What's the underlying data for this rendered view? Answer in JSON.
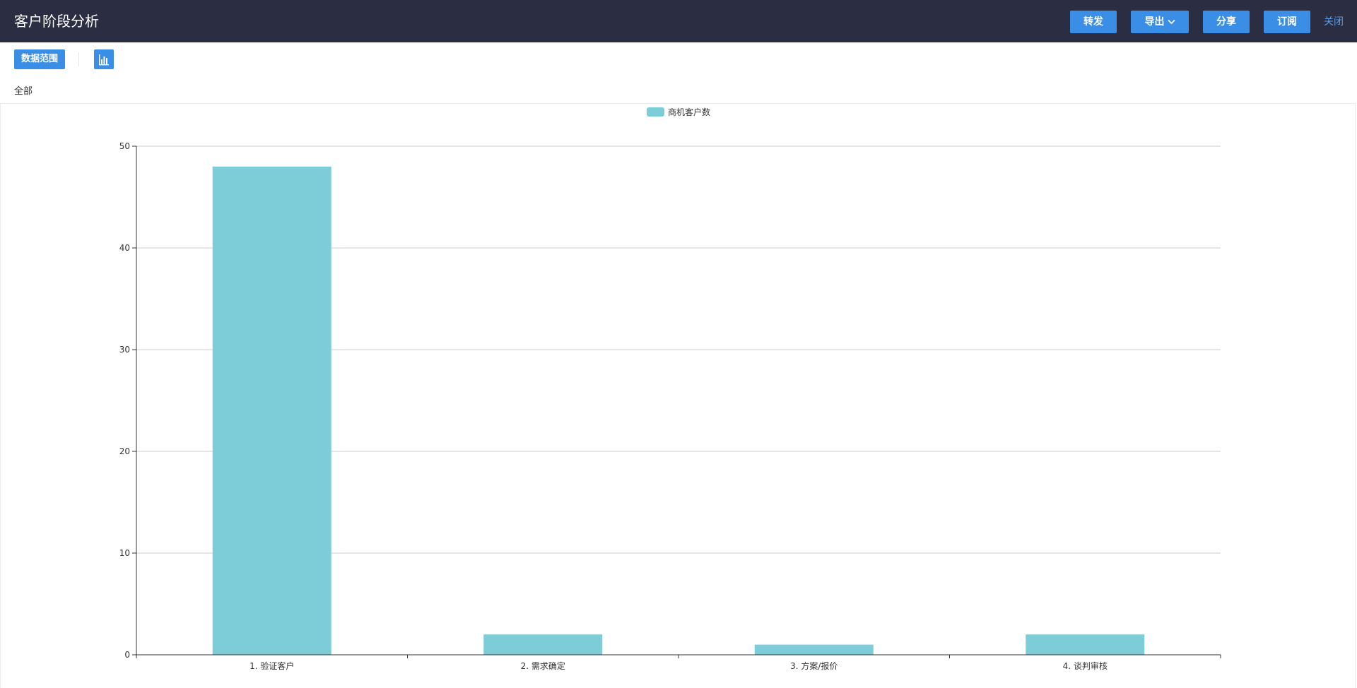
{
  "header": {
    "title": "客户阶段分析",
    "buttons": {
      "forward": "转发",
      "export": "导出",
      "share": "分享",
      "subscribe": "订阅",
      "close": "关闭"
    }
  },
  "toolbar": {
    "data_range_label": "数据范围",
    "chart_type_icon": "bar-chart-icon"
  },
  "filter": {
    "scope": "全部"
  },
  "colors": {
    "header_bg": "#2b2d42",
    "accent": "#3a8ee6",
    "bar": "#7ccdd8",
    "link": "#5b9be6"
  },
  "chart_data": {
    "type": "bar",
    "categories": [
      "1. 验证客户",
      "2. 需求确定",
      "3. 方案/报价",
      "4. 谈判审核"
    ],
    "series": [
      {
        "name": "商机客户数",
        "values": [
          48,
          2,
          1,
          2
        ]
      }
    ],
    "ylim": [
      0,
      50
    ],
    "yticks": [
      0,
      10,
      20,
      30,
      40,
      50
    ],
    "grid": true,
    "legend_position": "top-center"
  }
}
